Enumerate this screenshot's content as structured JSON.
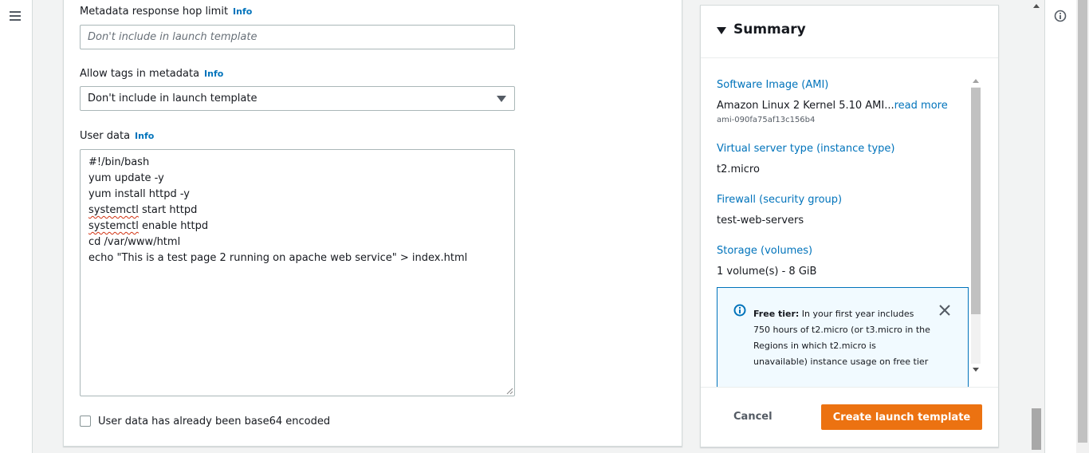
{
  "form": {
    "hop_limit": {
      "label": "Metadata response hop limit",
      "info": "Info",
      "placeholder": "Don't include in launch template",
      "value": ""
    },
    "allow_tags": {
      "label": "Allow tags in metadata",
      "info": "Info",
      "selected": "Don't include in launch template"
    },
    "user_data": {
      "label": "User data",
      "info": "Info",
      "lines": [
        "#!/bin/bash",
        "yum update -y",
        "yum install httpd -y",
        "start httpd",
        "enable httpd",
        "cd /var/www/html",
        "echo \"This is a test page 2 running on apache web service\" > index.html"
      ],
      "misspelled_word": "systemctl"
    },
    "base64_checkbox": {
      "label": "User data has already been base64 encoded",
      "checked": false
    }
  },
  "summary": {
    "title": "Summary",
    "ami": {
      "label": "Software Image (AMI)",
      "value": "Amazon Linux 2 Kernel 5.10 AMI...",
      "read_more": "read more",
      "id": "ami-090fa75af13c156b4"
    },
    "instance_type": {
      "label": "Virtual server type (instance type)",
      "value": "t2.micro"
    },
    "firewall": {
      "label": "Firewall (security group)",
      "value": "test-web-servers"
    },
    "storage": {
      "label": "Storage (volumes)",
      "value": "1 volume(s) - 8 GiB"
    },
    "free_tier": {
      "title": "Free tier:",
      "text": " In your first year includes 750 hours of t2.micro (or t3.micro in the Regions in which t2.micro is unavailable) instance usage on free tier"
    },
    "cancel_label": "Cancel",
    "create_label": "Create launch template"
  },
  "colors": {
    "link": "#0073bb",
    "primary_button": "#ec7211",
    "alert_bg": "#f1faff",
    "alert_border": "#0073bb"
  },
  "icons": {
    "nav": "hamburger-menu-icon",
    "info": "info-circle-icon",
    "close": "close-icon",
    "caret": "caret-down-icon"
  }
}
